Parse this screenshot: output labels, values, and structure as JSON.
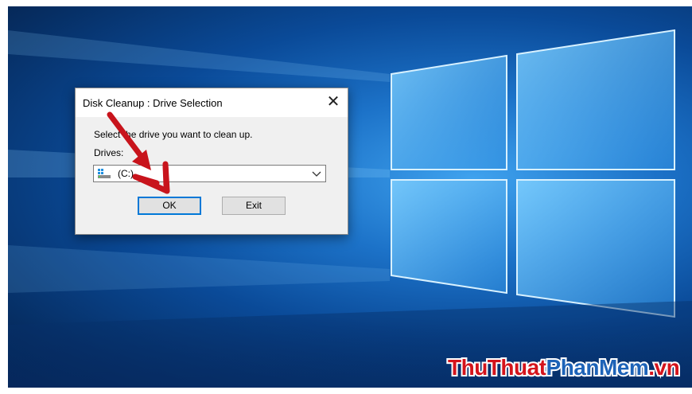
{
  "dialog": {
    "title": "Disk Cleanup : Drive Selection",
    "close_glyph": "✕",
    "prompt": "Select the drive you want to clean up.",
    "drives_label": "Drives:",
    "selected_drive": "(C:)",
    "ok_label": "OK",
    "exit_label": "Exit"
  },
  "watermark": {
    "part1": "ThuThuat",
    "part2": "PhanMem",
    "part3": ".vn"
  },
  "icons": {
    "close": "close-icon",
    "drive": "drive-icon",
    "dropdown": "chevron-down-icon"
  },
  "colors": {
    "accent": "#0078d7",
    "annotation_arrow": "#c8141c",
    "watermark_red": "#d4141c",
    "watermark_blue": "#1d63b8"
  }
}
